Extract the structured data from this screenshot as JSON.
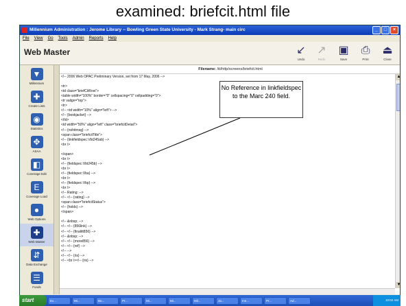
{
  "slide": {
    "title": "examined:  briefcit.html file"
  },
  "window": {
    "title": "Millennium Administration : Jerome Library -- Bowling Green State University - Mark Strang- main circ",
    "controls": [
      "_",
      "□",
      "×"
    ]
  },
  "menu": [
    "File",
    "View",
    "Go",
    "Tools",
    "Admin",
    "Reports",
    "Help"
  ],
  "toolbar": {
    "module_title": "Web Master",
    "buttons": [
      {
        "label": "Undo",
        "icon": "undo-icon",
        "glyph": "↙",
        "enabled": true
      },
      {
        "label": "Redo",
        "icon": "redo-icon",
        "glyph": "↗",
        "enabled": false
      },
      {
        "label": "Save",
        "icon": "save-icon",
        "glyph": "▣",
        "enabled": true
      },
      {
        "label": "Print",
        "icon": "print-icon",
        "glyph": "⎙",
        "enabled": true
      },
      {
        "label": "Close",
        "icon": "close-icon",
        "glyph": "⏏",
        "enabled": true
      }
    ]
  },
  "sidebar": {
    "items": [
      {
        "label": "Millennium",
        "icon": "millennium-icon",
        "glyph": "▼"
      },
      {
        "label": "Create Lists",
        "icon": "create-lists-icon",
        "glyph": "✚"
      },
      {
        "label": "Statistics",
        "icon": "statistics-icon",
        "glyph": "◉"
      },
      {
        "label": "ASAA",
        "icon": "asaa-icon",
        "glyph": "✥"
      },
      {
        "label": "Coverage Edit",
        "icon": "coverage-edit-icon",
        "glyph": "◧"
      },
      {
        "label": "Coverage Load",
        "icon": "coverage-load-icon",
        "glyph": "E"
      },
      {
        "label": "Web Options",
        "icon": "web-options-icon",
        "glyph": "●"
      },
      {
        "label": "Web Master",
        "icon": "web-master-icon",
        "glyph": "✚",
        "active": true
      },
      {
        "label": "Data Exchange",
        "icon": "data-exchange-icon",
        "glyph": "⇵"
      },
      {
        "label": "Funds",
        "icon": "funds-icon",
        "glyph": "☰"
      }
    ]
  },
  "editor": {
    "filename_label": "Filename:",
    "filename": "/iii/http/screens/briefcit.html",
    "lines": [
      "<!-- 2006 Web OPAC Preliminary Version, set from 17 May, 2006 -->",
      "",
      "<tr>",
      "<td class=\"briefCitRow\">",
      "<table width=\"100%\" border=\"0\" cellspacing=\"0\" cellpadding=\"0\">",
      "<tr valign=\"top\">",
      "<tr>",
      "<!-- <td width=\"10%\" align=\"left\"> -->",
      "<!-- {bookjacket} -->",
      "</td>",
      "<td width=\"50%\" align=\"left\" class=\"briefcitDetail\">",
      "<!-- {nohitmsg} -->",
      "<span class=\"briefcitTitle\">",
      "<!-- {linkfieldspec:Vbt245ab} -->",
      "<br />",
      "",
      "</span>",
      "<br />",
      "<!-- {fieldspec:Vbt245b} -->",
      "<br />",
      "<!-- {fieldspec:Vba} -->",
      "<br />",
      "<!-- {fieldspec:Vbp} -->",
      "<br />",
      "<!-- Rating: -->",
      "<!-- <!-- {rating} -->",
      "<span class=\"briefcitStatus\">",
      "<!-- {holds} -->",
      "</span>",
      "",
      "<!-- &nbsp; -->",
      "<!-- <!-- {856link} -->",
      "<!-- <!-- {finalitt856} -->",
      "<!-- &nbsp; -->",
      "<!-- <!-- {more856} -->",
      "<!-- <!-- {ref} -->",
      "<!-- -->",
      "<!-- <!-- {ris} -->",
      "<!-- <br /><!-- {ris} -->"
    ]
  },
  "callout": {
    "text": "No Reference in linkfieldspec to the Marc 240 field."
  },
  "taskbar": {
    "start_label": "start",
    "items": [
      "Ex...",
      "Mi...",
      "Bo...",
      "Pr...",
      "Mi...",
      "Mi...",
      "Mil...",
      "Ja...",
      "Inn...",
      "Pr...",
      "Ad..."
    ],
    "clock": "10:02 AM"
  }
}
